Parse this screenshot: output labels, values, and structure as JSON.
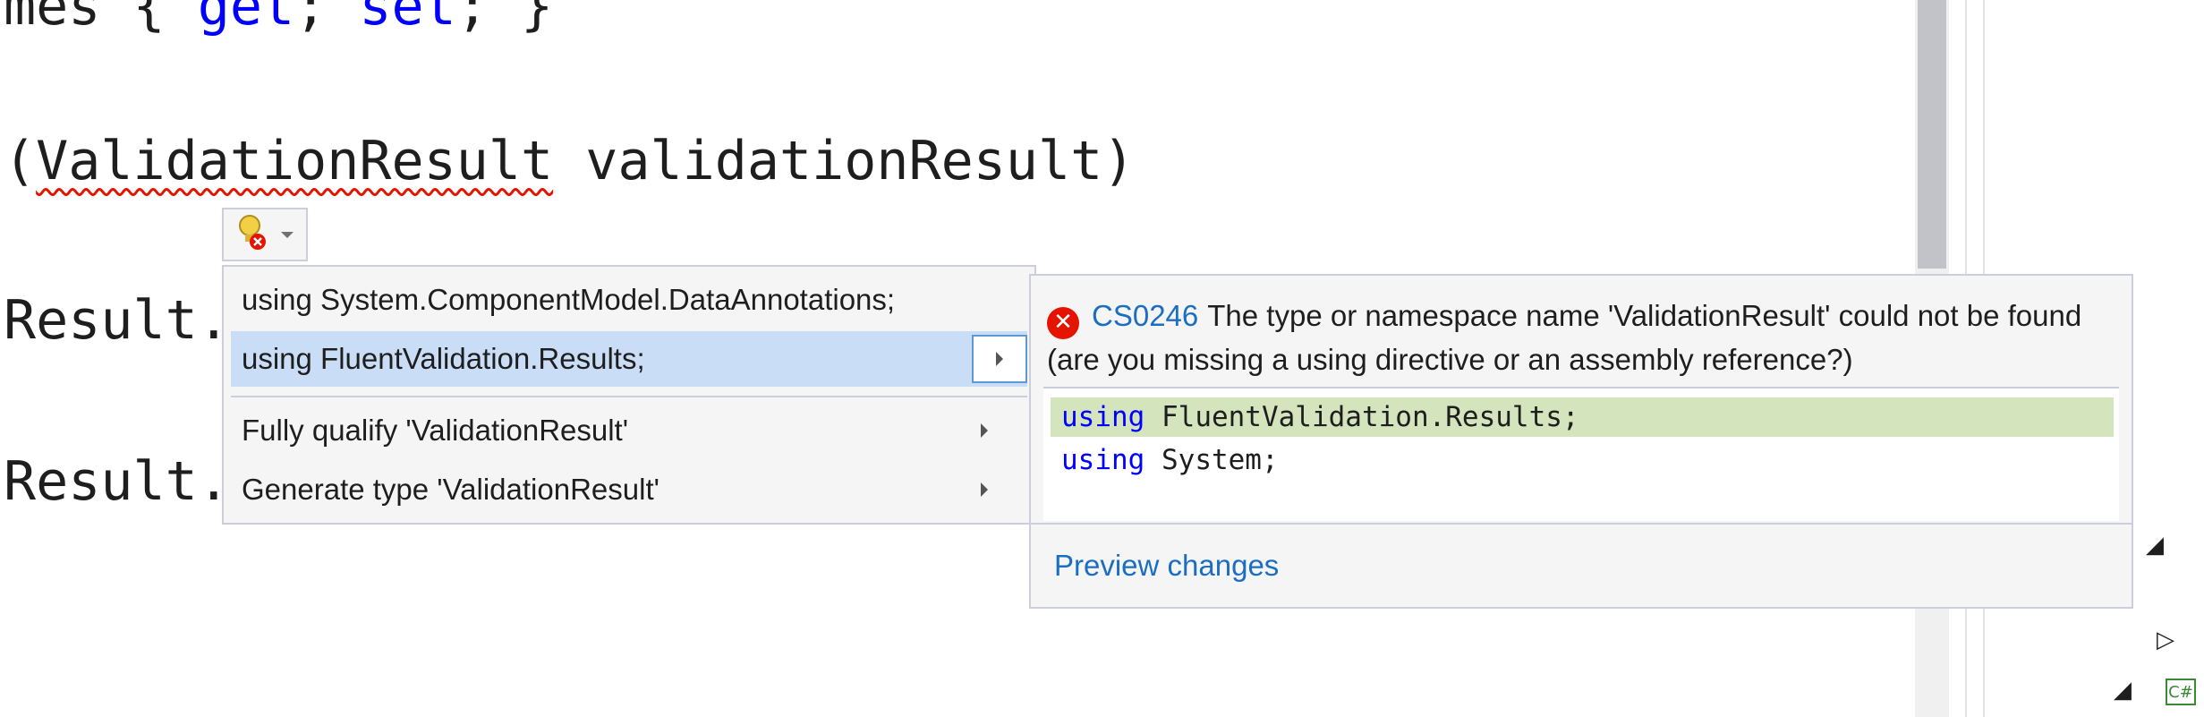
{
  "editor": {
    "line1": {
      "prefix": "mes { ",
      "kw1": "get",
      "sep": "; ",
      "kw2": "set",
      "suffix": "; }"
    },
    "line2": {
      "open": "(",
      "type": "ValidationResult",
      "rest": " validationResult)"
    },
    "line3": "Result.",
    "line4": "Result."
  },
  "lightbulb": {
    "icon": "lightbulb-error-icon"
  },
  "quick_actions": {
    "items": [
      {
        "label": "using System.ComponentModel.DataAnnotations;",
        "selected": false,
        "submenu": false
      },
      {
        "label": "using FluentValidation.Results;",
        "selected": true,
        "submenu": true
      },
      {
        "label": "Fully qualify 'ValidationResult'",
        "selected": false,
        "submenu": true
      },
      {
        "label": "Generate type 'ValidationResult'",
        "selected": false,
        "submenu": true
      }
    ]
  },
  "preview": {
    "error_icon": "error-circle-icon",
    "error_code": "CS0246",
    "message": "The type or namespace name 'ValidationResult' could not be found (are you missing a using directive or an assembly reference?)",
    "diff": [
      {
        "keyword": "using",
        "text": " FluentValidation.Results;",
        "added": true
      },
      {
        "keyword": "using",
        "text": " System;",
        "added": false
      }
    ],
    "footer_link": "Preview changes"
  },
  "side": {
    "language_badge": "C#",
    "colors": {
      "accent": "#1c6ec3",
      "error": "#e51400",
      "selection": "#c9ddf6",
      "diff_added": "#d4e5bd"
    }
  }
}
